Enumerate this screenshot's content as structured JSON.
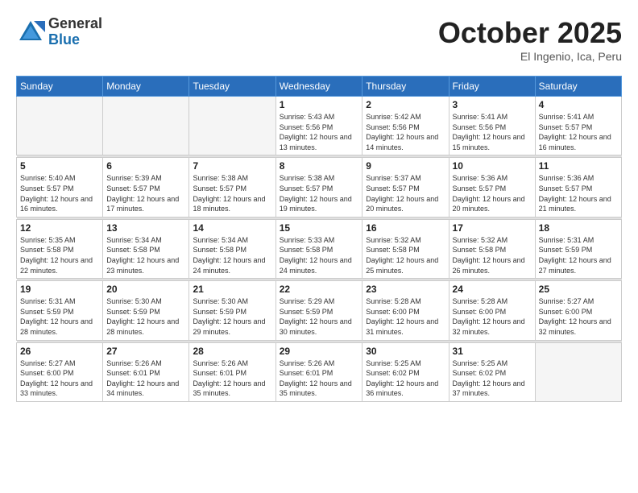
{
  "header": {
    "logo_general": "General",
    "logo_blue": "Blue",
    "title": "October 2025",
    "location": "El Ingenio, Ica, Peru"
  },
  "weekdays": [
    "Sunday",
    "Monday",
    "Tuesday",
    "Wednesday",
    "Thursday",
    "Friday",
    "Saturday"
  ],
  "weeks": [
    [
      {
        "day": "",
        "info": ""
      },
      {
        "day": "",
        "info": ""
      },
      {
        "day": "",
        "info": ""
      },
      {
        "day": "1",
        "info": "Sunrise: 5:43 AM\nSunset: 5:56 PM\nDaylight: 12 hours\nand 13 minutes."
      },
      {
        "day": "2",
        "info": "Sunrise: 5:42 AM\nSunset: 5:56 PM\nDaylight: 12 hours\nand 14 minutes."
      },
      {
        "day": "3",
        "info": "Sunrise: 5:41 AM\nSunset: 5:56 PM\nDaylight: 12 hours\nand 15 minutes."
      },
      {
        "day": "4",
        "info": "Sunrise: 5:41 AM\nSunset: 5:57 PM\nDaylight: 12 hours\nand 16 minutes."
      }
    ],
    [
      {
        "day": "5",
        "info": "Sunrise: 5:40 AM\nSunset: 5:57 PM\nDaylight: 12 hours\nand 16 minutes."
      },
      {
        "day": "6",
        "info": "Sunrise: 5:39 AM\nSunset: 5:57 PM\nDaylight: 12 hours\nand 17 minutes."
      },
      {
        "day": "7",
        "info": "Sunrise: 5:38 AM\nSunset: 5:57 PM\nDaylight: 12 hours\nand 18 minutes."
      },
      {
        "day": "8",
        "info": "Sunrise: 5:38 AM\nSunset: 5:57 PM\nDaylight: 12 hours\nand 19 minutes."
      },
      {
        "day": "9",
        "info": "Sunrise: 5:37 AM\nSunset: 5:57 PM\nDaylight: 12 hours\nand 20 minutes."
      },
      {
        "day": "10",
        "info": "Sunrise: 5:36 AM\nSunset: 5:57 PM\nDaylight: 12 hours\nand 20 minutes."
      },
      {
        "day": "11",
        "info": "Sunrise: 5:36 AM\nSunset: 5:57 PM\nDaylight: 12 hours\nand 21 minutes."
      }
    ],
    [
      {
        "day": "12",
        "info": "Sunrise: 5:35 AM\nSunset: 5:58 PM\nDaylight: 12 hours\nand 22 minutes."
      },
      {
        "day": "13",
        "info": "Sunrise: 5:34 AM\nSunset: 5:58 PM\nDaylight: 12 hours\nand 23 minutes."
      },
      {
        "day": "14",
        "info": "Sunrise: 5:34 AM\nSunset: 5:58 PM\nDaylight: 12 hours\nand 24 minutes."
      },
      {
        "day": "15",
        "info": "Sunrise: 5:33 AM\nSunset: 5:58 PM\nDaylight: 12 hours\nand 24 minutes."
      },
      {
        "day": "16",
        "info": "Sunrise: 5:32 AM\nSunset: 5:58 PM\nDaylight: 12 hours\nand 25 minutes."
      },
      {
        "day": "17",
        "info": "Sunrise: 5:32 AM\nSunset: 5:58 PM\nDaylight: 12 hours\nand 26 minutes."
      },
      {
        "day": "18",
        "info": "Sunrise: 5:31 AM\nSunset: 5:59 PM\nDaylight: 12 hours\nand 27 minutes."
      }
    ],
    [
      {
        "day": "19",
        "info": "Sunrise: 5:31 AM\nSunset: 5:59 PM\nDaylight: 12 hours\nand 28 minutes."
      },
      {
        "day": "20",
        "info": "Sunrise: 5:30 AM\nSunset: 5:59 PM\nDaylight: 12 hours\nand 28 minutes."
      },
      {
        "day": "21",
        "info": "Sunrise: 5:30 AM\nSunset: 5:59 PM\nDaylight: 12 hours\nand 29 minutes."
      },
      {
        "day": "22",
        "info": "Sunrise: 5:29 AM\nSunset: 5:59 PM\nDaylight: 12 hours\nand 30 minutes."
      },
      {
        "day": "23",
        "info": "Sunrise: 5:28 AM\nSunset: 6:00 PM\nDaylight: 12 hours\nand 31 minutes."
      },
      {
        "day": "24",
        "info": "Sunrise: 5:28 AM\nSunset: 6:00 PM\nDaylight: 12 hours\nand 32 minutes."
      },
      {
        "day": "25",
        "info": "Sunrise: 5:27 AM\nSunset: 6:00 PM\nDaylight: 12 hours\nand 32 minutes."
      }
    ],
    [
      {
        "day": "26",
        "info": "Sunrise: 5:27 AM\nSunset: 6:00 PM\nDaylight: 12 hours\nand 33 minutes."
      },
      {
        "day": "27",
        "info": "Sunrise: 5:26 AM\nSunset: 6:01 PM\nDaylight: 12 hours\nand 34 minutes."
      },
      {
        "day": "28",
        "info": "Sunrise: 5:26 AM\nSunset: 6:01 PM\nDaylight: 12 hours\nand 35 minutes."
      },
      {
        "day": "29",
        "info": "Sunrise: 5:26 AM\nSunset: 6:01 PM\nDaylight: 12 hours\nand 35 minutes."
      },
      {
        "day": "30",
        "info": "Sunrise: 5:25 AM\nSunset: 6:02 PM\nDaylight: 12 hours\nand 36 minutes."
      },
      {
        "day": "31",
        "info": "Sunrise: 5:25 AM\nSunset: 6:02 PM\nDaylight: 12 hours\nand 37 minutes."
      },
      {
        "day": "",
        "info": ""
      }
    ]
  ]
}
